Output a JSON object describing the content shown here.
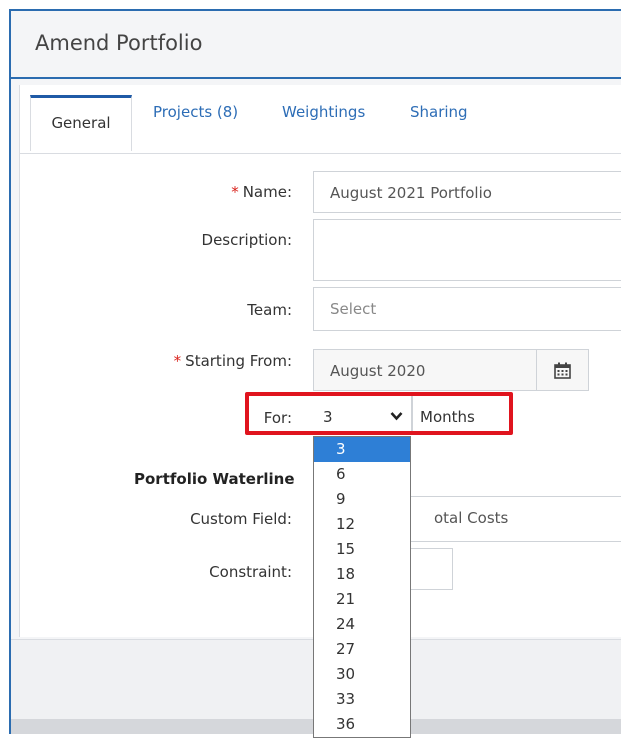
{
  "window": {
    "title": "Amend Portfolio"
  },
  "tabs": [
    {
      "label": "General",
      "active": true
    },
    {
      "label": "Projects (8)",
      "active": false
    },
    {
      "label": "Weightings",
      "active": false
    },
    {
      "label": "Sharing",
      "active": false
    }
  ],
  "form": {
    "name_label": "Name:",
    "name_value": "August 2021 Portfolio",
    "required_mark": "*",
    "description_label": "Description:",
    "team_label": "Team:",
    "team_placeholder": "Select",
    "starting_from_label": "Starting From:",
    "starting_from_value": "August 2020",
    "for_label": "For:",
    "for_value": "3",
    "for_unit": "Months",
    "section_heading": "Portfolio Waterline",
    "custom_field_label": "Custom Field:",
    "custom_field_value": "otal Costs",
    "constraint_label": "Constraint:"
  },
  "dropdown": {
    "options": [
      "3",
      "6",
      "9",
      "12",
      "15",
      "18",
      "21",
      "24",
      "27",
      "30",
      "33",
      "36"
    ],
    "selected": "3"
  },
  "colors": {
    "accent": "#2b6cb0",
    "highlight": "#e0141e",
    "selected_option": "#2e7fd6",
    "required": "#d9221c"
  }
}
